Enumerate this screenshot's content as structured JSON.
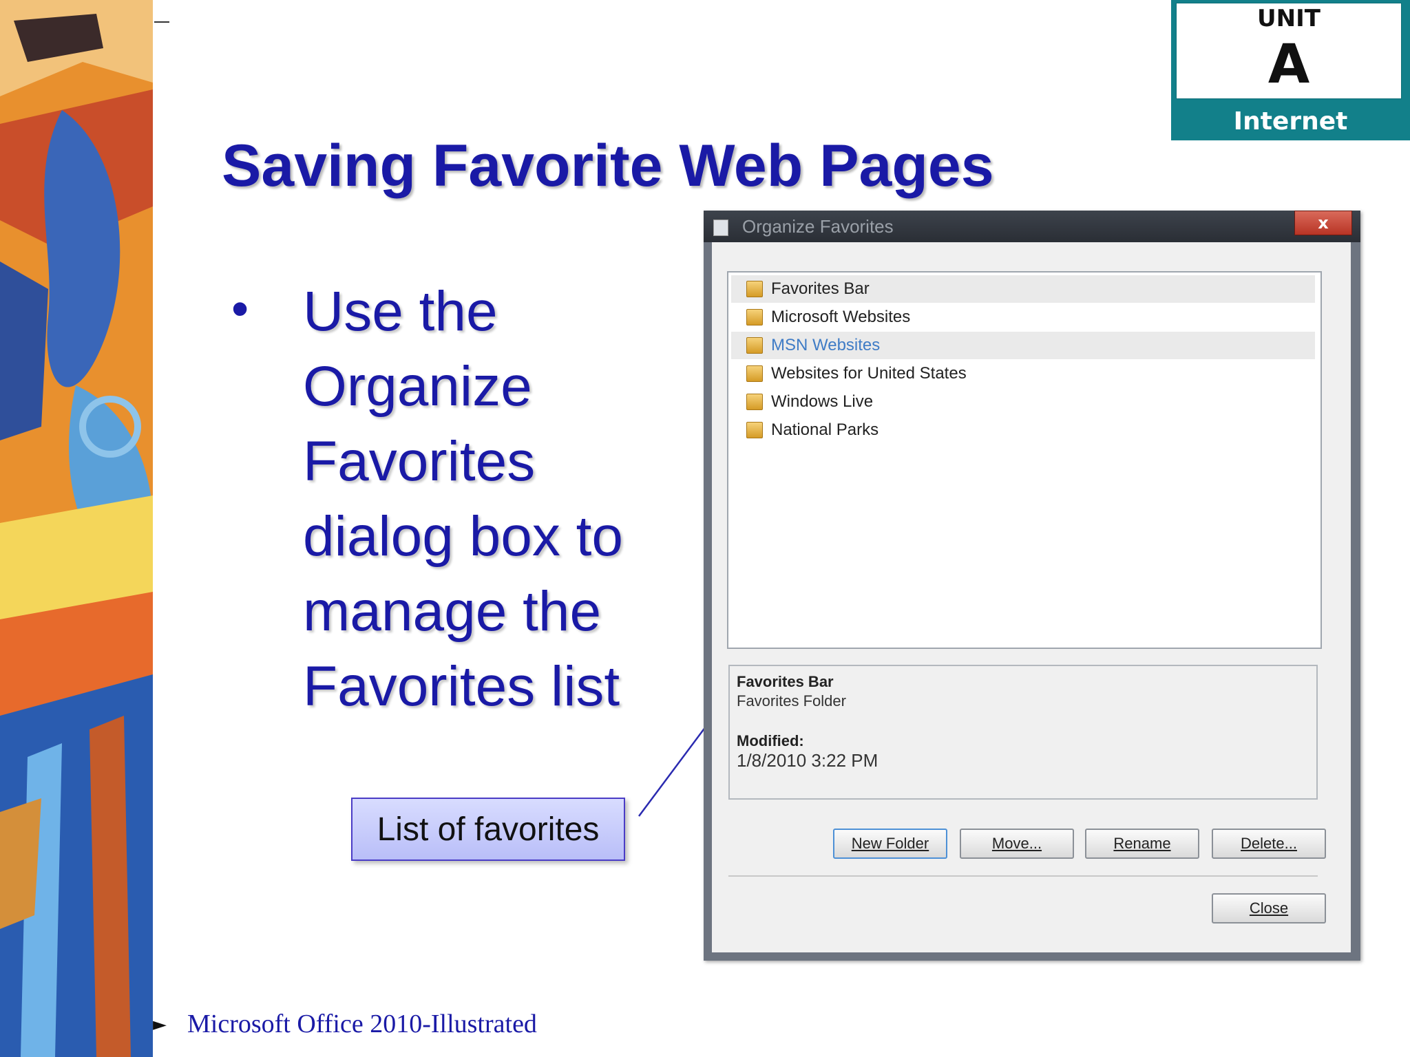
{
  "unit_badge": {
    "unit": "UNIT",
    "letter": "A",
    "label": "Internet"
  },
  "title": "Saving Favorite Web Pages",
  "bullet": {
    "marker": "•",
    "text": "Use the Organize Favorites dialog box to manage the Favorites list"
  },
  "callout": "List of favorites",
  "dialog": {
    "title": "Organize Favorites",
    "close_glyph": "x",
    "favorites": [
      {
        "name": "Favorites Bar"
      },
      {
        "name": "Microsoft Websites"
      },
      {
        "name": "MSN Websites"
      },
      {
        "name": "Websites for United States"
      },
      {
        "name": "Windows Live"
      },
      {
        "name": "National Parks"
      }
    ],
    "selected_index": 2,
    "details": {
      "name": "Favorites Bar",
      "type": "Favorites Folder",
      "modified_label": "Modified:",
      "modified_value": "1/8/2010 3:22 PM"
    },
    "buttons": {
      "new_folder": "New Folder",
      "move": "Move...",
      "rename": "Rename",
      "delete": "Delete...",
      "close": "Close"
    }
  },
  "footer": {
    "marker": "►",
    "text": "Microsoft Office 2010-Illustrated"
  },
  "colors": {
    "title": "#1a1aa6",
    "badge": "#12808a",
    "callout_border": "#4a3cc6",
    "selected_item": "#3f7cc6"
  }
}
